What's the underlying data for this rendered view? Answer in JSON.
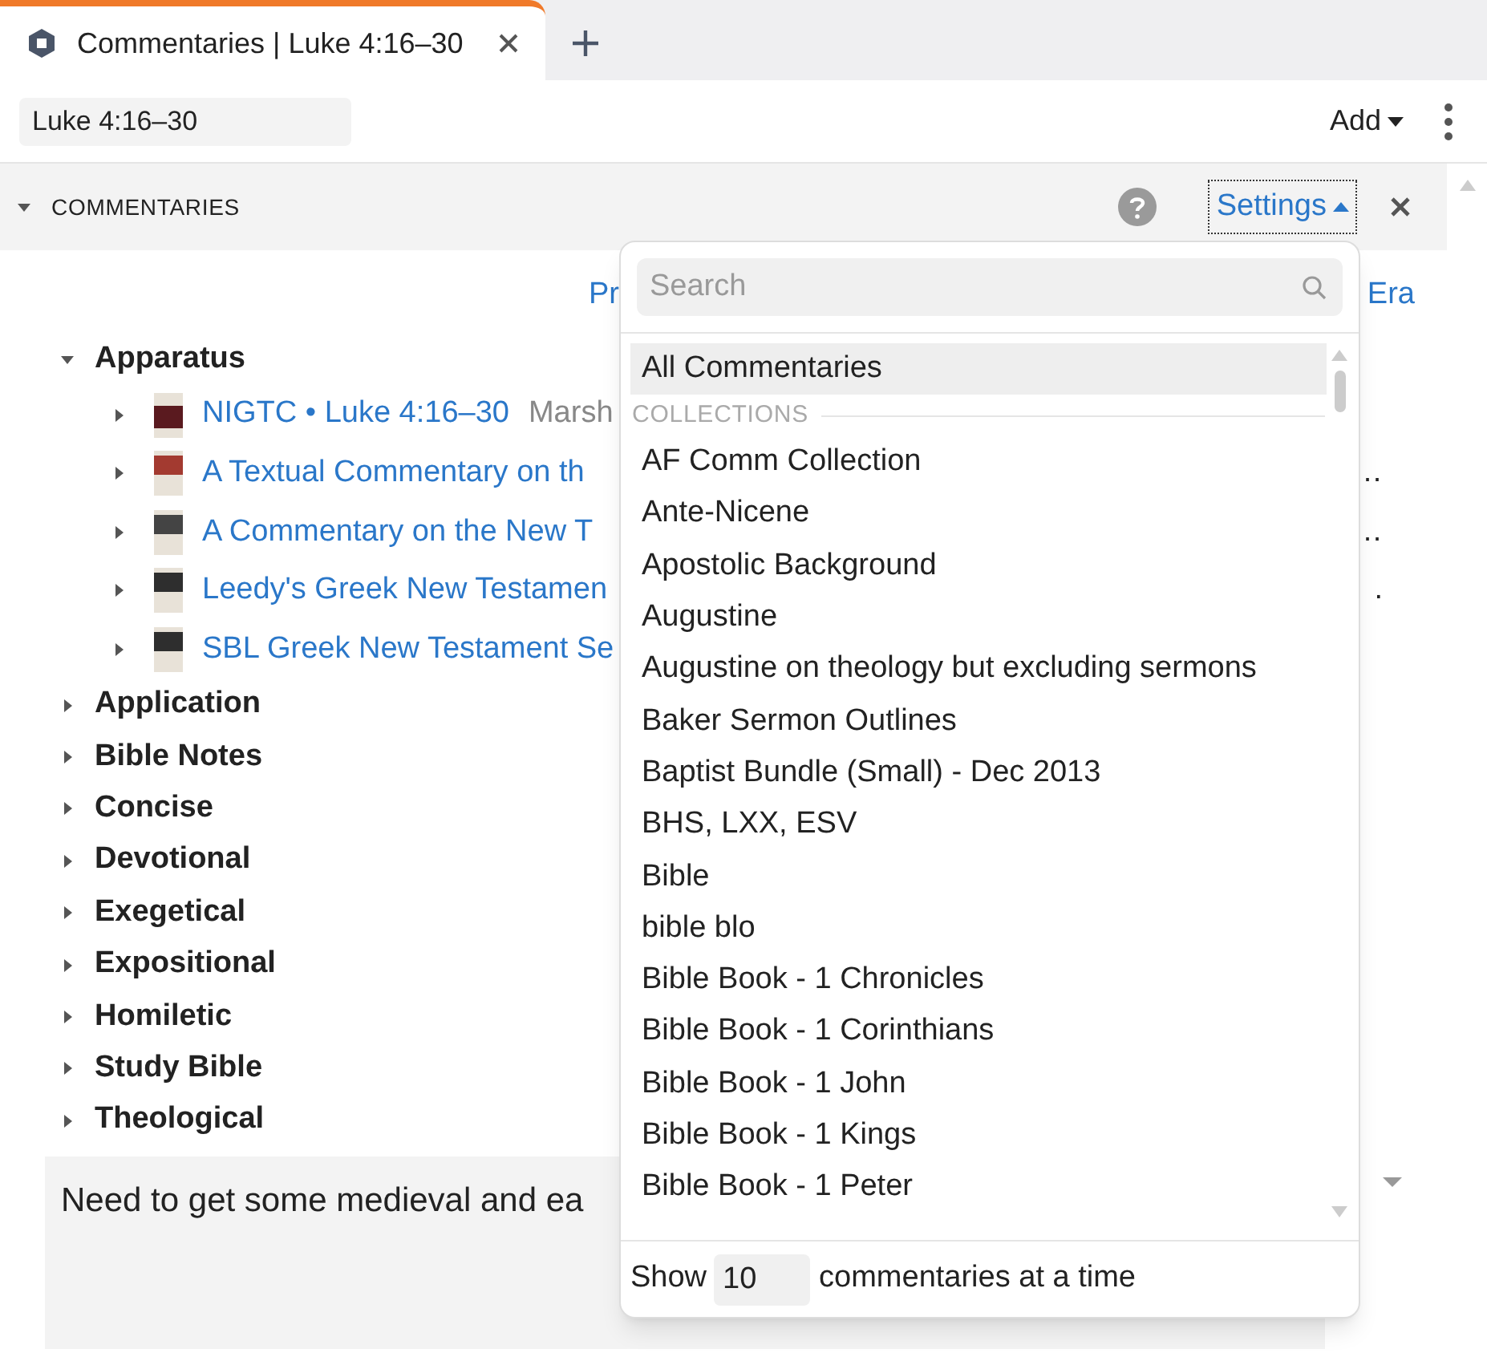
{
  "tab": {
    "title": "Commentaries | Luke 4:16–30",
    "selected": true
  },
  "reference": {
    "value": "Luke 4:16–30"
  },
  "toolbar": {
    "add": "Add"
  },
  "panel": {
    "title": "COMMENTARIES",
    "settings": "Settings",
    "expanded": true
  },
  "header_links": [
    "Pr",
    "Era"
  ],
  "groups": [
    {
      "label": "Apparatus",
      "expanded": true,
      "children": [
        {
          "title": "NIGTC • Luke 4:16–30",
          "author": "Marsh"
        },
        {
          "title": "A Textual Commentary on th",
          "tail": "…"
        },
        {
          "title": "A Commentary on the New T",
          "tail": "…"
        },
        {
          "title": "Leedy's Greek New Testamen",
          "tail": "."
        },
        {
          "title": "SBL Greek New Testament Se"
        }
      ]
    },
    {
      "label": "Application",
      "expanded": false
    },
    {
      "label": "Bible Notes",
      "expanded": false
    },
    {
      "label": "Concise",
      "expanded": false
    },
    {
      "label": "Devotional",
      "expanded": false
    },
    {
      "label": "Exegetical",
      "expanded": false
    },
    {
      "label": "Expositional",
      "expanded": false
    },
    {
      "label": "Homiletic",
      "expanded": false
    },
    {
      "label": "Study Bible",
      "expanded": false
    },
    {
      "label": "Theological",
      "expanded": false
    }
  ],
  "note": {
    "text": "Need to get some medieval and ea"
  },
  "dropdown": {
    "search": {
      "placeholder": "Search"
    },
    "items": [
      {
        "kind": "item",
        "label": "All Commentaries",
        "selected": true
      },
      {
        "kind": "heading",
        "label": "COLLECTIONS"
      },
      {
        "kind": "item",
        "label": "AF Comm Collection",
        "selected": false
      },
      {
        "kind": "item",
        "label": "Ante-Nicene",
        "selected": false
      },
      {
        "kind": "item",
        "label": "Apostolic Background",
        "selected": false
      },
      {
        "kind": "item",
        "label": "Augustine",
        "selected": false
      },
      {
        "kind": "item",
        "label": "Augustine on theology but excluding sermons",
        "selected": false
      },
      {
        "kind": "item",
        "label": "Baker Sermon Outlines",
        "selected": false
      },
      {
        "kind": "item",
        "label": "Baptist Bundle (Small) - Dec 2013",
        "selected": false
      },
      {
        "kind": "item",
        "label": "BHS, LXX, ESV",
        "selected": false
      },
      {
        "kind": "item",
        "label": "Bible",
        "selected": false
      },
      {
        "kind": "item",
        "label": "bible blo",
        "selected": false
      },
      {
        "kind": "item",
        "label": "Bible Book - 1 Chronicles",
        "selected": false
      },
      {
        "kind": "item",
        "label": "Bible Book - 1 Corinthians",
        "selected": false
      },
      {
        "kind": "item",
        "label": "Bible Book - 1 John",
        "selected": false
      },
      {
        "kind": "item",
        "label": "Bible Book - 1 Kings",
        "selected": false
      },
      {
        "kind": "item",
        "label": "Bible Book - 1 Peter",
        "selected": false
      }
    ],
    "show_label": "Show",
    "show_count": "10",
    "show_suffix": "commentaries at a time"
  }
}
